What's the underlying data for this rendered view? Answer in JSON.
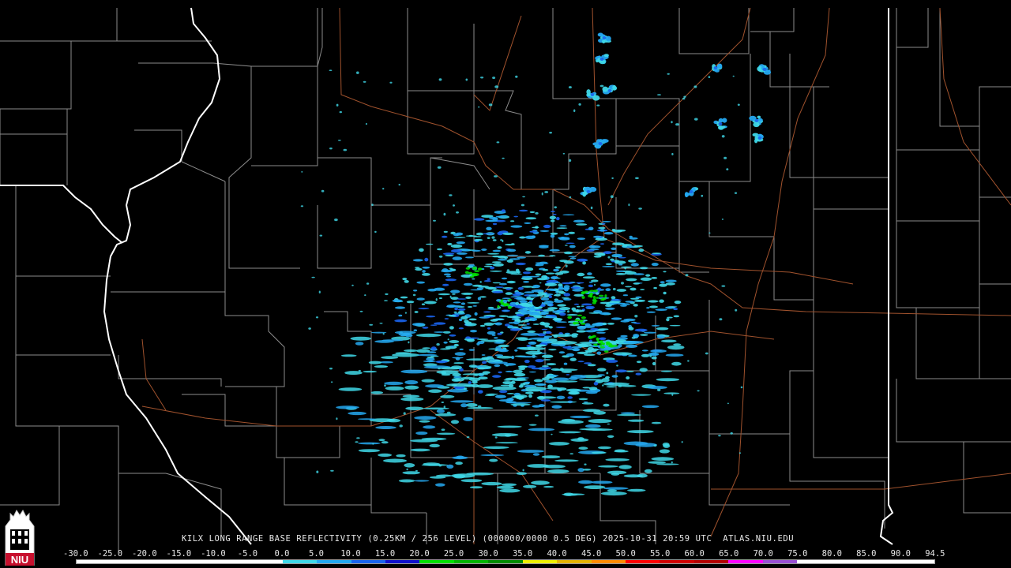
{
  "caption": "KILX LONG RANGE BASE REFLECTIVITY (0.25KM / 256 LEVEL) (000000/0000 0.5 DEG) 2025-10-31 20:59 UTC  ATLAS.NIU.EDU",
  "logo_text": "NIU",
  "scale": {
    "labels": [
      "-30.0",
      "-25.0",
      "-20.0",
      "-15.0",
      "-10.0",
      "-5.0",
      "0.0",
      "5.0",
      "10.0",
      "15.0",
      "20.0",
      "25.0",
      "30.0",
      "35.0",
      "40.0",
      "45.0",
      "50.0",
      "55.0",
      "60.0",
      "65.0",
      "70.0",
      "75.0",
      "80.0",
      "85.0",
      "90.0",
      "94.5"
    ],
    "colors": [
      "#ffffff",
      "#ffffff",
      "#ffffff",
      "#ffffff",
      "#ffffff",
      "#ffffff",
      "#3fd8e8",
      "#24a8f0",
      "#1a64ee",
      "#1010cc",
      "#00e000",
      "#00b400",
      "#008c00",
      "#f0f000",
      "#e4b400",
      "#ff8c00",
      "#ff0000",
      "#d00000",
      "#b40000",
      "#ff00ff",
      "#9a50d4",
      "#ffffff",
      "#ffffff",
      "#ffffff",
      "#ffffff"
    ]
  },
  "palette": {
    "boundary_county": "#8c8c8c",
    "boundary_state": "#ffffff",
    "highway": "#a0522d",
    "echo_light": "#3fd8e8",
    "echo_mid": "#24a8f0",
    "echo_blue": "#1a64ee",
    "echo_green": "#00e000"
  }
}
